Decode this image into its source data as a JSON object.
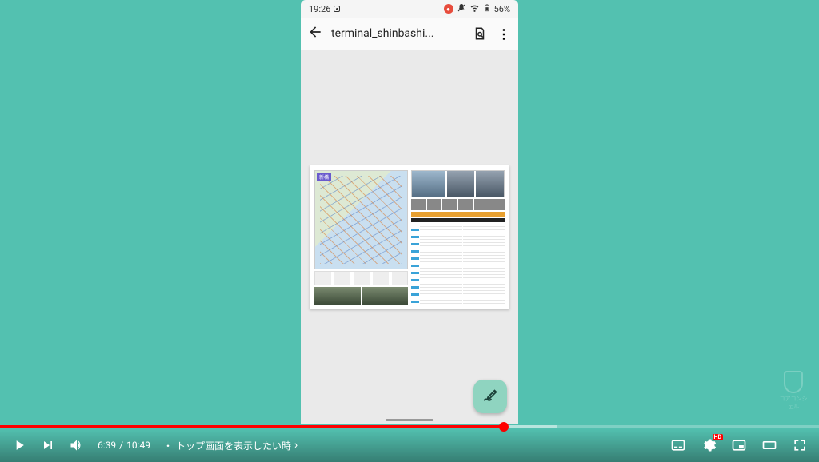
{
  "phone": {
    "status": {
      "time": "19:26",
      "battery_text": "56%"
    },
    "appbar": {
      "title": "terminal_shinbashi..."
    },
    "map_label": "新橋"
  },
  "watermark": {
    "text": "コアコンシェル"
  },
  "player": {
    "current_time": "6:39",
    "duration": "10:49",
    "chapter_prefix": "・",
    "chapter_title": "トップ画面を表示したい時",
    "hd_label": "HD",
    "progress_percent": 61.5
  }
}
